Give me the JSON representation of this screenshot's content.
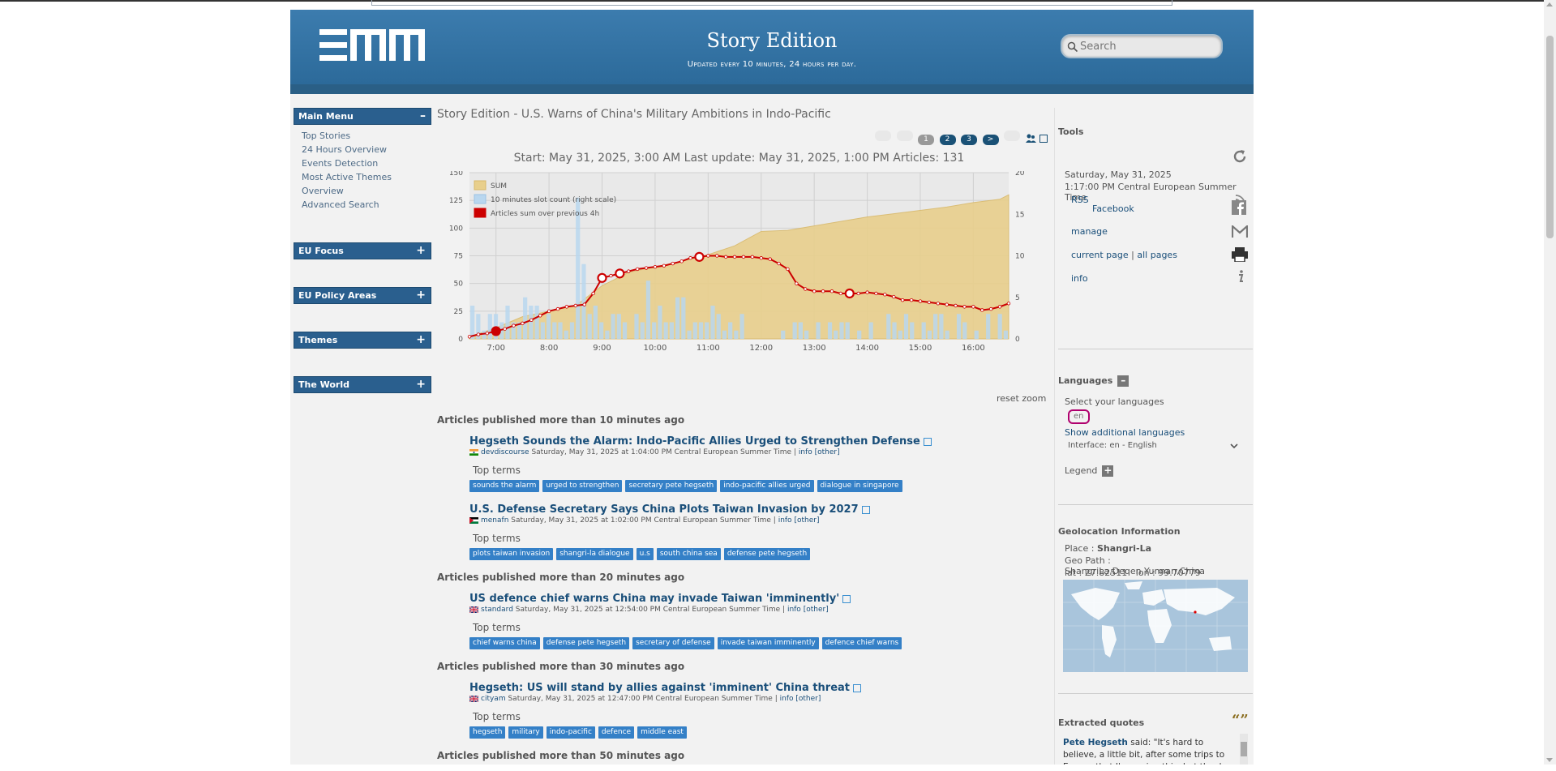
{
  "header": {
    "logo_text": "EMM",
    "title": "Story Edition",
    "subtitle": "Updated every 10 minutes, 24 hours per day.",
    "search_placeholder": "Search"
  },
  "menus": [
    {
      "title": "Main Menu",
      "toggle": "–",
      "items": [
        "Top Stories",
        "24 Hours Overview",
        "Events Detection",
        "Most Active Themes",
        "Overview",
        "Advanced Search"
      ]
    },
    {
      "title": "EU Focus",
      "toggle": "+",
      "items": []
    },
    {
      "title": "EU Policy Areas",
      "toggle": "+",
      "items": []
    },
    {
      "title": "Themes",
      "toggle": "+",
      "items": []
    },
    {
      "title": "The World",
      "toggle": "+",
      "items": []
    }
  ],
  "story": {
    "title": "Story Edition - U.S. Warns of China's Military Ambitions in Indo-Pacific",
    "pages": [
      "1",
      "2",
      "3",
      ">"
    ],
    "chart_header": "Start: May 31, 2025, 3:00 AM Last update: May 31, 2025, 1:00 PM Articles: 131",
    "reset_zoom": "reset zoom"
  },
  "chart_data": {
    "type": "area",
    "x_ticks": [
      "7:00",
      "8:00",
      "9:00",
      "10:00",
      "11:00",
      "12:00",
      "13:00",
      "14:00",
      "15:00",
      "16:00"
    ],
    "x_range": [
      "6:30",
      "16:40"
    ],
    "y_left_ticks": [
      0,
      25,
      50,
      75,
      100,
      125,
      150
    ],
    "y_right_ticks": [
      0,
      5,
      10,
      15,
      20
    ],
    "ylim_left": [
      0,
      150
    ],
    "ylim_right": [
      0,
      20
    ],
    "legend_position": "top-left",
    "grid": true,
    "series": [
      {
        "name": "SUM",
        "type": "area",
        "color": "#e8cf8c",
        "x": [
          "6:30",
          "7:00",
          "7:30",
          "8:00",
          "8:30",
          "9:00",
          "9:30",
          "10:00",
          "10:30",
          "11:00",
          "11:30",
          "12:00",
          "12:30",
          "13:00",
          "13:30",
          "14:00",
          "14:30",
          "15:00",
          "15:30",
          "16:00",
          "16:30",
          "16:40"
        ],
        "values": [
          2,
          10,
          20,
          25,
          30,
          48,
          60,
          65,
          70,
          76,
          84,
          97,
          98,
          102,
          106,
          110,
          113,
          116,
          119,
          123,
          126,
          130
        ]
      },
      {
        "name": "10 minutes slot count (right scale)",
        "type": "bar",
        "color": "#b9d7ef",
        "values": [
          4,
          3,
          1,
          3,
          3,
          2,
          4,
          2,
          2,
          5,
          4,
          4,
          2,
          3,
          2,
          2,
          1,
          2,
          17,
          9,
          3,
          4,
          2,
          1,
          3,
          3,
          2,
          0,
          3,
          2,
          7,
          2,
          4,
          2,
          2,
          5,
          5,
          1,
          2,
          2,
          2,
          4,
          3,
          1,
          2,
          1,
          3,
          0,
          0,
          0,
          0,
          0,
          0,
          1,
          0,
          2,
          2,
          1,
          0,
          2,
          0,
          2,
          1,
          2,
          2,
          0,
          1,
          0,
          2,
          0,
          0,
          3,
          2,
          1,
          3,
          2,
          0,
          2,
          1,
          3,
          3,
          1,
          0,
          3,
          2,
          0,
          1,
          0,
          3,
          0,
          3,
          1
        ]
      },
      {
        "name": "Articles sum over previous 4h",
        "type": "line",
        "color": "#cc0000",
        "x": [
          "6:30",
          "6:40",
          "6:50",
          "7:00",
          "7:10",
          "7:20",
          "7:30",
          "7:40",
          "7:50",
          "8:00",
          "8:10",
          "8:20",
          "8:30",
          "8:40",
          "8:50",
          "9:00",
          "9:10",
          "9:20",
          "9:30",
          "9:40",
          "9:50",
          "10:00",
          "10:10",
          "10:20",
          "10:30",
          "10:40",
          "10:50",
          "11:00",
          "11:10",
          "11:20",
          "11:30",
          "11:40",
          "11:50",
          "12:00",
          "12:10",
          "12:20",
          "12:30",
          "12:40",
          "12:50",
          "13:00",
          "13:10",
          "13:20",
          "13:30",
          "13:40",
          "13:50",
          "14:00",
          "14:10",
          "14:20",
          "14:30",
          "14:40",
          "14:50",
          "15:00",
          "15:10",
          "15:20",
          "15:30",
          "15:40",
          "15:50",
          "16:00",
          "16:10",
          "16:20",
          "16:30",
          "16:40"
        ],
        "values": [
          2,
          4,
          5,
          7,
          9,
          12,
          14,
          17,
          21,
          25,
          27,
          29,
          30,
          31,
          41,
          55,
          57,
          59,
          61,
          63,
          64,
          65,
          66,
          68,
          70,
          73,
          74,
          75,
          75,
          74,
          74,
          74,
          74,
          73,
          72,
          68,
          63,
          50,
          45,
          43,
          43,
          43,
          41,
          41,
          41,
          42,
          41,
          40,
          38,
          35,
          35,
          34,
          33,
          32,
          31,
          30,
          29,
          29,
          26,
          27,
          29,
          32
        ],
        "highlight": [
          3,
          15,
          17,
          26,
          43
        ]
      }
    ],
    "legend": [
      "SUM",
      "10 minutes slot count (right scale)",
      "Articles sum over previous 4h"
    ]
  },
  "article_groups": [
    {
      "label": "Articles published more than  10  minutes  ago",
      "articles": [
        {
          "title": "Hegseth Sounds the Alarm: Indo-Pacific Allies Urged to Strengthen Defense",
          "source": "devdiscourse",
          "time": "Saturday, May 31, 2025 at 1:04:00 PM Central European Summer Time",
          "info": "info",
          "other": "[other]",
          "flag": "in",
          "terms": [
            "sounds the alarm",
            "urged to strengthen",
            "secretary pete hegseth",
            "indo-pacific allies urged",
            "dialogue in singapore"
          ]
        },
        {
          "title": "U.S. Defense Secretary Says China Plots Taiwan Invasion by 2027",
          "source": "menafn",
          "time": "Saturday, May 31, 2025 at 1:02:00 PM Central European Summer Time",
          "info": "info",
          "other": "[other]",
          "flag": "jo",
          "terms": [
            "plots taiwan invasion",
            "shangri-la dialogue",
            "u.s",
            "south china sea",
            "defense pete hegseth"
          ]
        }
      ]
    },
    {
      "label": "Articles published more than  20  minutes  ago",
      "articles": [
        {
          "title": "US defence chief warns China may invade Taiwan 'imminently'",
          "source": "standard",
          "time": "Saturday, May 31, 2025 at 12:54:00 PM Central European Summer Time",
          "info": "info",
          "other": "[other]",
          "flag": "gb",
          "terms": [
            "chief warns china",
            "defense pete hegseth",
            "secretary of defense",
            "invade taiwan imminently",
            "defence chief warns"
          ]
        }
      ]
    },
    {
      "label": "Articles published more than  30  minutes  ago",
      "articles": [
        {
          "title": "Hegseth: US will stand by allies against 'imminent' China threat",
          "source": "cityam",
          "time": "Saturday, May 31, 2025 at 12:47:00 PM Central European Summer Time",
          "info": "info",
          "other": "[other]",
          "flag": "gb",
          "terms": [
            "hegseth",
            "military",
            "indo-pacific",
            "defence",
            "middle east"
          ]
        }
      ]
    },
    {
      "label": "Articles published more than  50  minutes  ago",
      "articles": []
    }
  ],
  "top_terms_label": "Top terms",
  "tools": {
    "title": "Tools",
    "date": "Saturday, May 31, 2025",
    "time": "1:17:00 PM Central European Summer Time",
    "rss": "RSS",
    "facebook": "Facebook",
    "manage": "manage",
    "current_page": "current page",
    "separator": "|",
    "all_pages": "all pages",
    "info": "info"
  },
  "languages": {
    "title": "Languages",
    "select_label": "Select your languages",
    "selected": "en",
    "show_more": "Show additional languages",
    "interface": "Interface: en - English",
    "legend": "Legend"
  },
  "geo": {
    "title": "Geolocation Information",
    "place_label": "Place : ",
    "place": "Shangri-La",
    "geo_path": "Geo Path : ShangriLa,Deqen,Yunnan,China",
    "lat": "lat : 27.82511",
    "lon": "lon : 99.70779"
  },
  "quotes": {
    "title": "Extracted quotes",
    "speaker": "Pete Hegseth",
    "said": " said: ",
    "text": "\"It's hard to believe, a little bit, after some trips to Europe that I'm saying this, but thanks to President Trump,"
  },
  "colors": {
    "header_blue": "#3a7aab",
    "menu_blue": "#2a5f8e",
    "tag_blue": "#3480c7",
    "sum_area": "#e8cf8c",
    "slot_bar": "#b9d7ef",
    "line_red": "#cc0000"
  }
}
